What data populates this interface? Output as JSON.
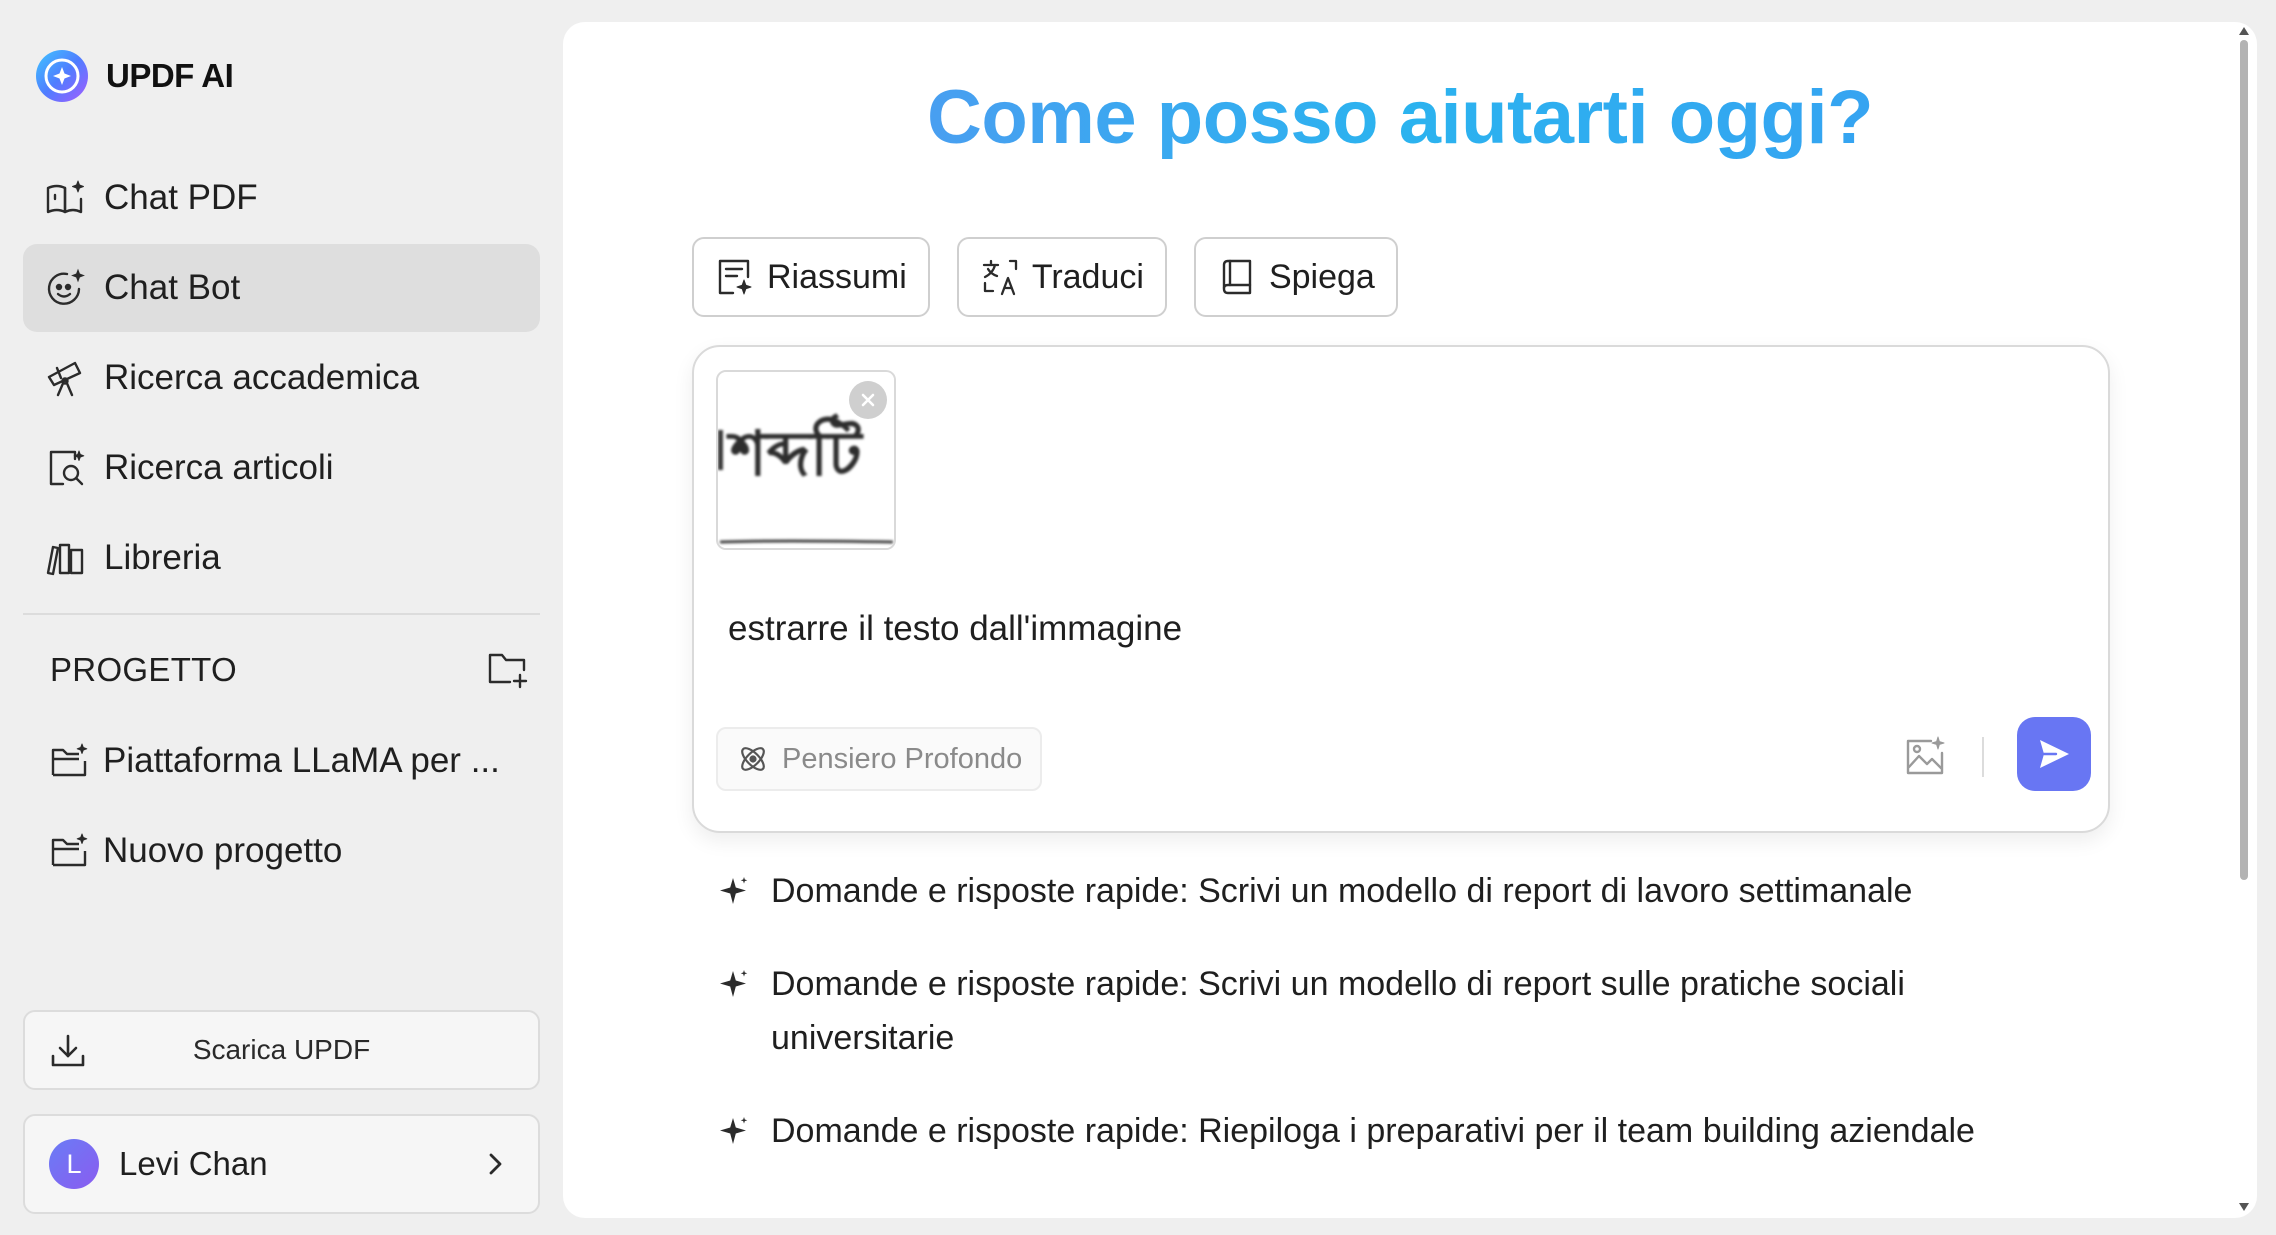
{
  "brand": {
    "name": "UPDF AI",
    "accent": "#6876f3"
  },
  "sidebar": {
    "items": [
      {
        "label": "Chat PDF",
        "icon": "book-sparkle-icon",
        "active": false
      },
      {
        "label": "Chat Bot",
        "icon": "bot-face-icon",
        "active": true
      },
      {
        "label": "Ricerca accademica",
        "icon": "telescope-icon",
        "active": false
      },
      {
        "label": "Ricerca articoli",
        "icon": "document-search-icon",
        "active": false
      },
      {
        "label": "Libreria",
        "icon": "library-icon",
        "active": false
      }
    ],
    "project_title": "PROGETTO",
    "projects": [
      {
        "label": "Piattaforma LLaMA per ..."
      },
      {
        "label": "Nuovo progetto"
      }
    ],
    "download_label": "Scarica UPDF",
    "user": {
      "initial": "L",
      "name": "Levi Chan"
    }
  },
  "main": {
    "hero": "Come posso aiutarti oggi?",
    "quick_actions": [
      {
        "label": "Riassumi",
        "icon": "summary-icon"
      },
      {
        "label": "Traduci",
        "icon": "translate-icon"
      },
      {
        "label": "Spiega",
        "icon": "book-icon"
      }
    ],
    "composer": {
      "attachment_text": "শব্দটি",
      "prompt": "estrarre il testo dall'immagine",
      "deep_think_label": "Pensiero Profondo"
    },
    "suggestions": [
      "Domande e risposte rapide: Scrivi un modello di report di lavoro settimanale",
      "Domande e risposte rapide: Scrivi un modello di report sulle pratiche sociali universitarie",
      "Domande e risposte rapide: Riepiloga i preparativi per il team building aziendale"
    ]
  }
}
